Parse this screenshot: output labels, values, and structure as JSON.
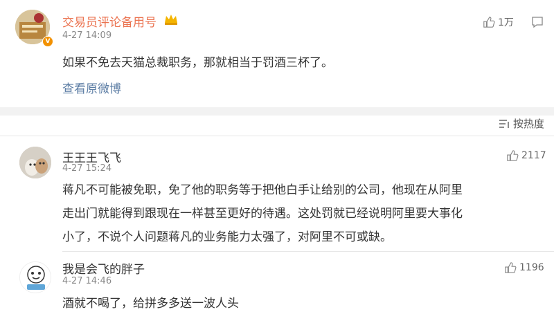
{
  "post": {
    "username": "交易员评论备用号",
    "time": "4-27 14:09",
    "likes": "1万",
    "content": "如果不免去天猫总裁职务，那就相当于罚酒三杯了。",
    "view_original": "查看原微博"
  },
  "sort": {
    "label": "按热度"
  },
  "comments": [
    {
      "username": "王王王飞飞",
      "time": "4-27 15:24",
      "likes": "2117",
      "lines": [
        "蒋凡不可能被免职，免了他的职务等于把他白手让给别的公司，他现在从阿里",
        "走出门就能得到跟现在一样甚至更好的待遇。这处罚就已经说明阿里要大事化",
        "小了，不说个人问题蒋凡的业务能力太强了，对阿里不可或缺。"
      ]
    },
    {
      "username": "我是会飞的胖子",
      "time": "4-27 14:46",
      "likes": "1196",
      "lines": [
        "酒就不喝了，给拼多多送一波人头"
      ]
    }
  ],
  "colors": {
    "author_name": "#eb7350",
    "link": "#5d7ea5",
    "badge": "#f29100"
  }
}
